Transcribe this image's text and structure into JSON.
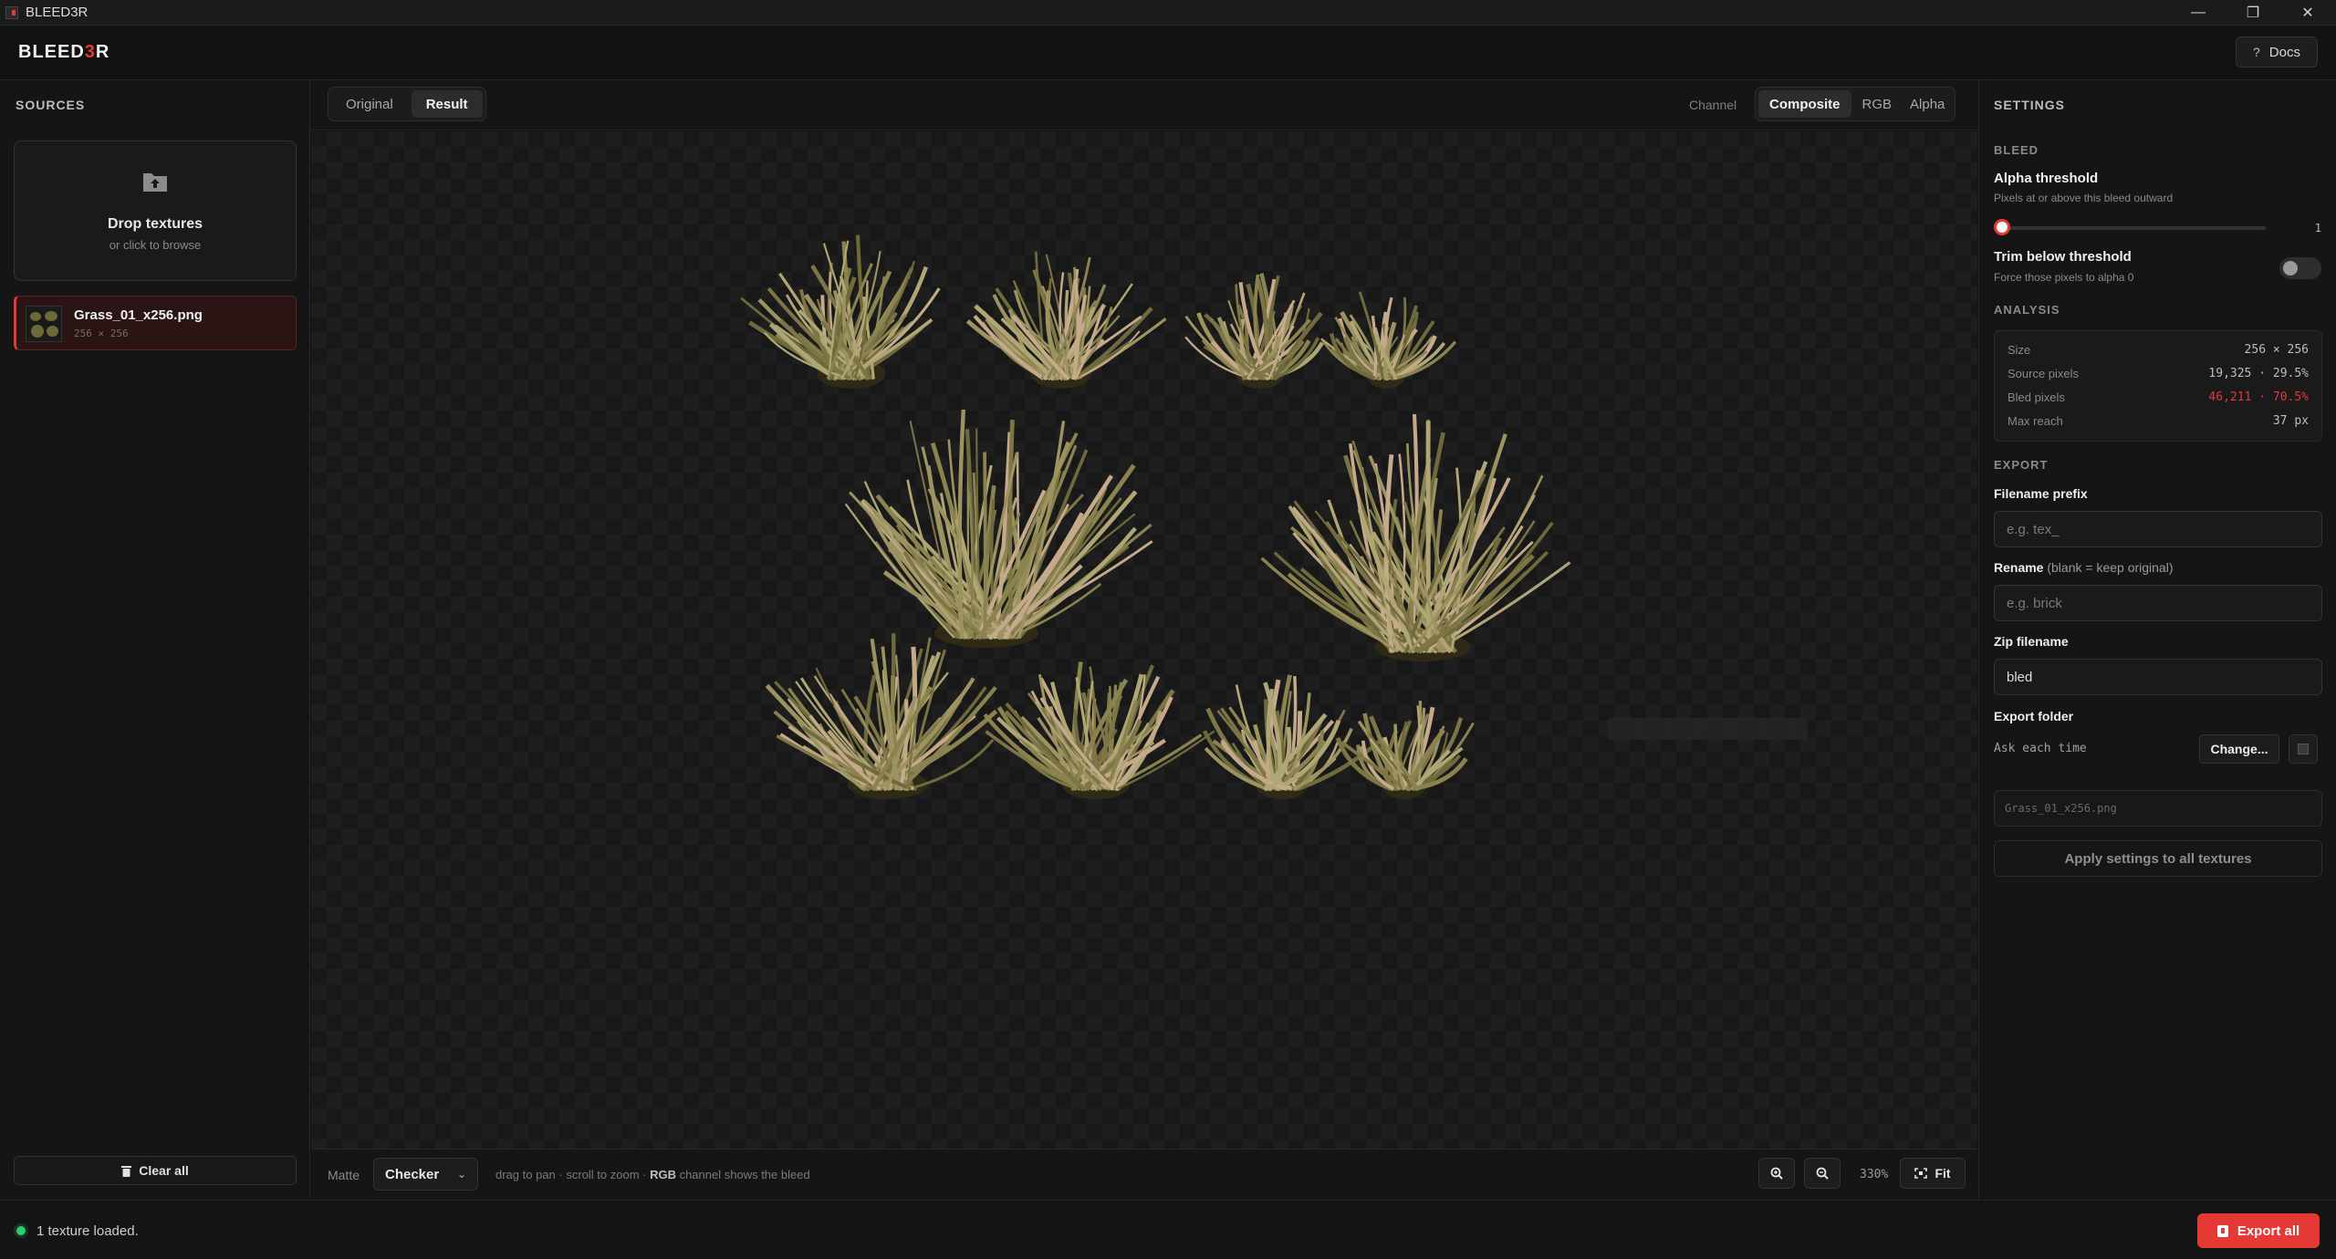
{
  "window": {
    "title": "BLEED3R"
  },
  "header": {
    "logo_main": "BLEED",
    "logo_accent": "3",
    "logo_tail": "R",
    "docs_label": "Docs"
  },
  "sources": {
    "title": "SOURCES",
    "drop_title": "Drop textures",
    "drop_sub": "or click to browse",
    "files": [
      {
        "name": "Grass_01_x256.png",
        "dims": "256 × 256"
      }
    ],
    "clear_label": "Clear all"
  },
  "viewer": {
    "view_tabs": [
      "Original",
      "Result"
    ],
    "active_view": "Result",
    "channel_label": "Channel",
    "channels": [
      "Composite",
      "RGB",
      "Alpha"
    ],
    "active_channel": "Composite",
    "matte_label": "Matte",
    "matte_value": "Checker",
    "hint_pre": "drag to pan · scroll to zoom · ",
    "hint_bold": "RGB",
    "hint_post": " channel shows the bleed",
    "zoom_level": "330%",
    "fit_label": "Fit"
  },
  "settings": {
    "title": "SETTINGS",
    "bleed_section": "BLEED",
    "alpha_threshold_label": "Alpha threshold",
    "alpha_threshold_sub": "Pixels at or above this bleed outward",
    "alpha_threshold_value": "1",
    "trim_label": "Trim below threshold",
    "trim_sub": "Force those pixels to alpha 0",
    "trim_enabled": false,
    "analysis_section": "ANALYSIS",
    "analysis": [
      {
        "key": "Size",
        "value": "256 × 256",
        "accent": false
      },
      {
        "key": "Source pixels",
        "value": "19,325 · 29.5%",
        "accent": false
      },
      {
        "key": "Bled pixels",
        "value": "46,211 · 70.5%",
        "accent": true
      },
      {
        "key": "Max reach",
        "value": "37 px",
        "accent": false
      }
    ],
    "export_section": "EXPORT",
    "prefix_label": "Filename prefix",
    "prefix_placeholder": "e.g. tex_",
    "rename_label": "Rename",
    "rename_hint": "(blank = keep original)",
    "rename_placeholder": "e.g. brick",
    "zip_label": "Zip filename",
    "zip_value": "bled",
    "folder_label": "Export folder",
    "folder_value": "Ask each time",
    "change_label": "Change...",
    "output_preview": "Grass_01_x256.png",
    "apply_label": "Apply settings to all textures"
  },
  "status": {
    "text": "1 texture loaded.",
    "export_label": "Export all"
  },
  "colors": {
    "accent": "#e53935",
    "status_ok": "#2ecc71",
    "grass": "#8a8350"
  }
}
